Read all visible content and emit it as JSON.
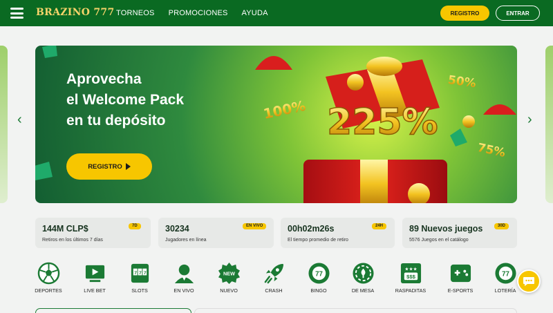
{
  "header": {
    "logo": "BRAZINO 777",
    "nav": [
      "TORNEOS",
      "PROMOCIONES",
      "AYUDA"
    ],
    "register_label": "REGISTRO",
    "login_label": "ENTRAR"
  },
  "hero": {
    "title_lines": [
      "Aprovecha",
      "el Welcome Pack",
      "en tu depósito"
    ],
    "cta_label": "REGISTRO",
    "promo_main": "225%",
    "promo_100": "100%",
    "promo_50": "50%",
    "promo_75": "75%"
  },
  "stats": [
    {
      "value": "144M CLP$",
      "label": "Retiros en los últimos 7 días",
      "badge": "7D"
    },
    {
      "value": "30234",
      "label": "Jugadores en línea",
      "badge": "EN VIVO"
    },
    {
      "value": "00h02m26s",
      "label": "El tiempo promedio de retiro",
      "badge": "24H"
    },
    {
      "value": "89 Nuevos juegos",
      "label": "5576 Juegos en el catálogo",
      "badge": "30D"
    }
  ],
  "categories": [
    {
      "label": "DEPORTES",
      "icon": "soccer-ball-icon"
    },
    {
      "label": "LIVE BET",
      "icon": "live-bet-icon"
    },
    {
      "label": "SLOTS",
      "icon": "slot-machine-icon"
    },
    {
      "label": "EN VIVO",
      "icon": "live-dealer-icon"
    },
    {
      "label": "NUEVO",
      "icon": "new-badge-icon",
      "icon_text": "NEW"
    },
    {
      "label": "CRASH",
      "icon": "rocket-icon"
    },
    {
      "label": "BINGO",
      "icon": "bingo-ball-icon",
      "icon_text": "77"
    },
    {
      "label": "DE MESA",
      "icon": "poker-chip-icon"
    },
    {
      "label": "RASPADITAS",
      "icon": "scratch-card-icon"
    },
    {
      "label": "E-SPORTS",
      "icon": "gamepad-icon"
    },
    {
      "label": "LOTERÍA",
      "icon": "lottery-ball-icon",
      "icon_text": "77"
    }
  ],
  "colors": {
    "brand_green": "#0a6a22",
    "accent_yellow": "#f7c600",
    "icon_green": "#1b7a34"
  }
}
